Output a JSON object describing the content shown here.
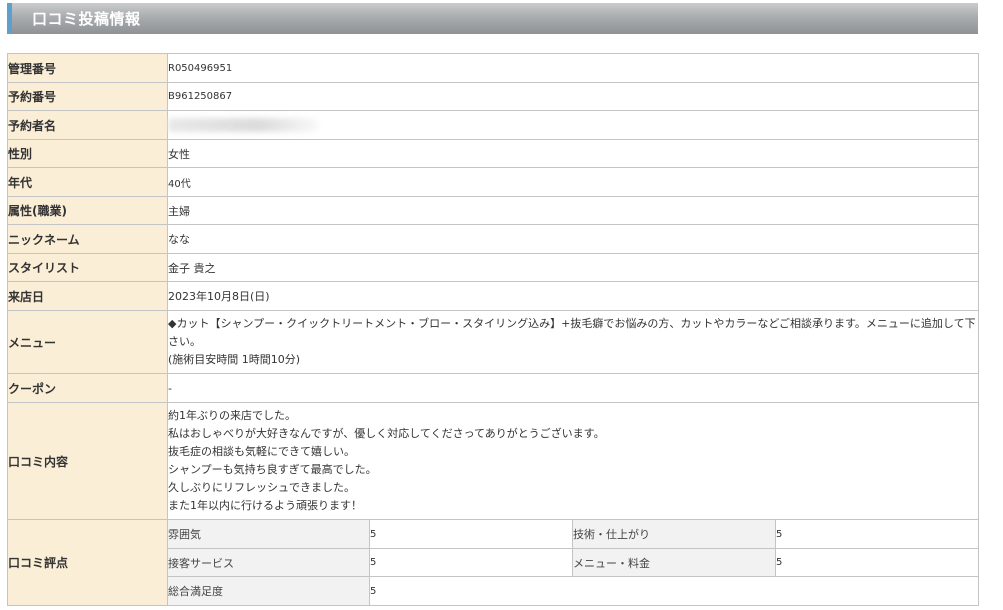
{
  "header": {
    "title": "口コミ投稿情報"
  },
  "rows": {
    "kanri_no": {
      "label": "管理番号",
      "value": "R050496951"
    },
    "yoyaku_no": {
      "label": "予約番号",
      "value": "B961250867"
    },
    "yoyakusha": {
      "label": "予約者名",
      "value": ""
    },
    "seibetsu": {
      "label": "性別",
      "value": "女性"
    },
    "nendai": {
      "label": "年代",
      "value": "40代"
    },
    "zokusei": {
      "label": "属性(職業)",
      "value": "主婦"
    },
    "nickname": {
      "label": "ニックネーム",
      "value": "なな"
    },
    "stylist": {
      "label": "スタイリスト",
      "value": "金子 貴之"
    },
    "raiten": {
      "label": "来店日",
      "value": "2023年10月8日(日)"
    },
    "menu": {
      "label": "メニュー",
      "value": "◆カット【シャンプー・クイックトリートメント・ブロー・スタイリング込み】+抜毛癖でお悩みの方、カットやカラーなどご相談承ります。メニューに追加して下さい。\n(施術目安時間 1時間10分)"
    },
    "coupon": {
      "label": "クーポン",
      "value": "-"
    },
    "kuchikomi": {
      "label": "口コミ内容",
      "value": "約1年ぶりの来店でした。\n私はおしゃべりが大好きなんですが、優しく対応してくださってありがとうございます。\n抜毛症の相談も気軽にできて嬉しい。\nシャンプーも気持ち良すぎて最高でした。\n久しぶりにリフレッシュできました。\nまた1年以内に行けるよう頑張ります！"
    }
  },
  "scores": {
    "label": "口コミ評点",
    "items": [
      {
        "label": "雰囲気",
        "value": "5"
      },
      {
        "label": "技術・仕上がり",
        "value": "5"
      },
      {
        "label": "接客サービス",
        "value": "5"
      },
      {
        "label": "メニュー・料金",
        "value": "5"
      },
      {
        "label": "総合満足度",
        "value": "5"
      }
    ]
  }
}
